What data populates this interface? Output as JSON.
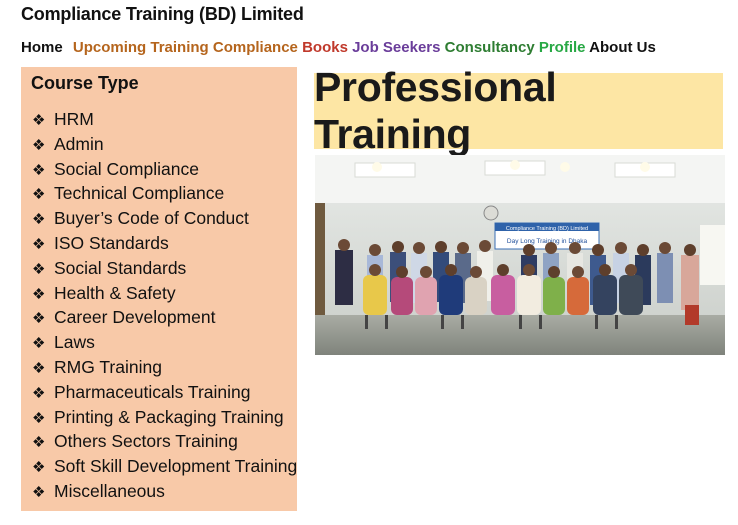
{
  "site": {
    "title": "Compliance Training (BD) Limited"
  },
  "nav": [
    {
      "label": "Home",
      "color": "#111111"
    },
    {
      "label": "Upcoming Training",
      "color": "#b5651d"
    },
    {
      "label": "Compliance",
      "color": "#b5651d"
    },
    {
      "label": "Books",
      "color": "#c0392b"
    },
    {
      "label": "Job Seekers",
      "color": "#6a3d9a"
    },
    {
      "label": "Consultancy",
      "color": "#2e7d32"
    },
    {
      "label": "Profile",
      "color": "#27a844"
    },
    {
      "label": "About Us",
      "color": "#111111"
    }
  ],
  "sidebar": {
    "title": "Course Type",
    "bullet": "❖",
    "items": [
      "HRM",
      "Admin",
      "Social Compliance",
      "Technical Compliance",
      "Buyer’s Code of Conduct",
      "ISO Standards",
      "Social Standards",
      "Health & Safety",
      "Career Development",
      "Laws",
      "RMG Training",
      "Pharmaceuticals Training",
      "Printing & Packaging Training",
      "Others Sectors Training",
      "Soft Skill Development Training",
      "Miscellaneous"
    ]
  },
  "banner": {
    "text": "Professional Training"
  },
  "photo": {
    "banner_title": "Compliance Training (BD) Limited",
    "banner_subtitle": "Day Long Training in Dhaka"
  },
  "colors": {
    "sidebar_bg": "#f8c9a8",
    "banner_bg": "#fde6a4"
  }
}
